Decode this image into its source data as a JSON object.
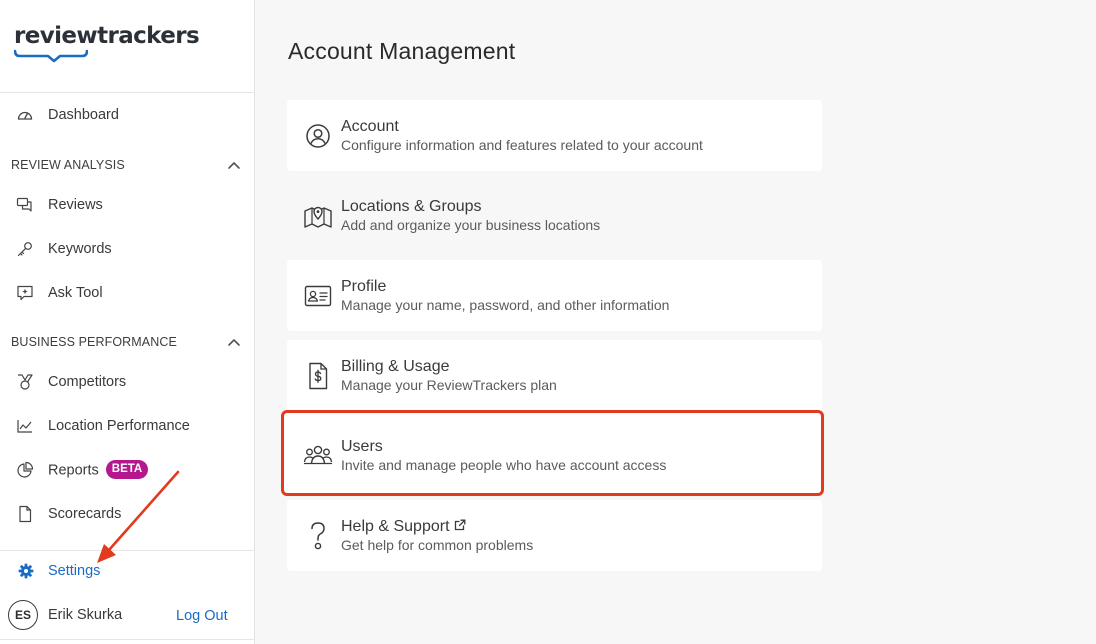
{
  "brand": {
    "name": "reviewtrackers",
    "accent": "#1a6bc4"
  },
  "sidebar": {
    "dashboard": {
      "label": "Dashboard",
      "icon": "dashboard-icon"
    },
    "review_analysis": {
      "title": "REVIEW ANALYSIS",
      "items": [
        {
          "label": "Reviews",
          "icon": "chat-bubbles-icon"
        },
        {
          "label": "Keywords",
          "icon": "key-icon"
        },
        {
          "label": "Ask Tool",
          "icon": "sparkle-chat-icon"
        }
      ]
    },
    "business_performance": {
      "title": "BUSINESS PERFORMANCE",
      "items": [
        {
          "label": "Competitors",
          "icon": "medal-icon"
        },
        {
          "label": "Location Performance",
          "icon": "trend-chart-icon"
        },
        {
          "label": "Reports",
          "icon": "pie-chart-icon",
          "badge": "BETA"
        },
        {
          "label": "Scorecards",
          "icon": "document-icon"
        }
      ]
    },
    "settings": {
      "label": "Settings",
      "icon": "gear-icon"
    },
    "user": {
      "initials": "ES",
      "name": "Erik Skurka",
      "logout_label": "Log Out"
    }
  },
  "main": {
    "title": "Account Management",
    "cards": [
      {
        "title": "Account",
        "desc": "Configure information and features related to your account",
        "icon": "user-circle-icon"
      },
      {
        "title": "Locations & Groups",
        "desc": "Add and organize your business locations",
        "icon": "map-pin-icon"
      },
      {
        "title": "Profile",
        "desc": "Manage your name, password, and other information",
        "icon": "id-card-icon"
      },
      {
        "title": "Billing & Usage",
        "desc": "Manage your ReviewTrackers plan",
        "icon": "invoice-icon"
      },
      {
        "title": "Users",
        "desc": "Invite and manage people who have account access",
        "icon": "users-group-icon"
      },
      {
        "title": "Help & Support",
        "desc": "Get help for common problems",
        "icon": "question-icon"
      }
    ]
  },
  "annotation": {
    "highlight_color": "#e23a1f"
  }
}
